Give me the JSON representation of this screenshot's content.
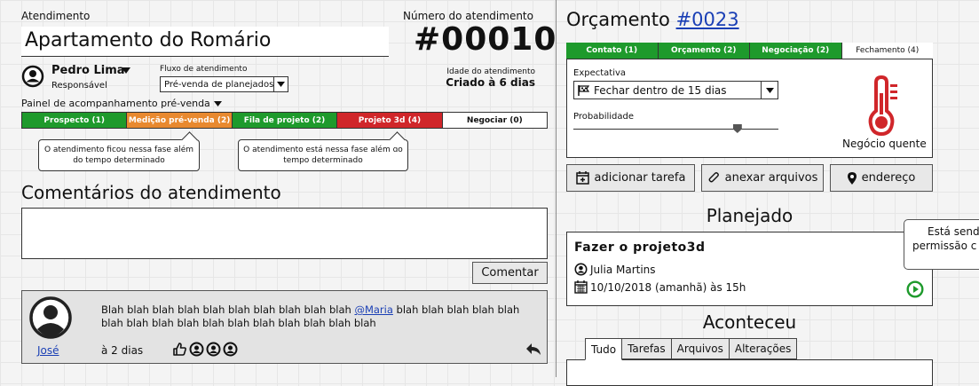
{
  "left": {
    "atendimento_label": "Atendimento",
    "atendimento_title": "Apartamento do Romário",
    "numero_label": "Número do atendimento",
    "numero_value": "#00010",
    "user_name": "Pedro Lima",
    "user_role": "Responsável",
    "fluxo_label": "Fluxo de atendimento",
    "fluxo_value": "Pré-venda de planejados",
    "idade_label": "Idade do atendimento",
    "idade_value": "Criado à 6 dias",
    "painel_label": "Painel de acompanhamento pré-venda",
    "stages": [
      {
        "label": "Prospecto (1)",
        "color": "#1e9a2c"
      },
      {
        "label": "Medição pré-venda (2)",
        "color": "#e8892f"
      },
      {
        "label": "Fila de projeto (2)",
        "color": "#1e9a2c"
      },
      {
        "label": "Projeto 3d (4)",
        "color": "#d0262a"
      },
      {
        "label": "Negociar (0)",
        "color": "#ffffff"
      }
    ],
    "tip1": "O atendimento ficou nessa fase além do tempo determinado",
    "tip2": "O atendimento está nessa fase além do tempo determinado",
    "comments_title": "Comentários do atendimento",
    "comment_button": "Comentar",
    "comment": {
      "author": "José",
      "text_before": "Blah blah blah blah blah blah blah blah blah blah ",
      "mention": "@Maria",
      "text_after": " blah blah blah blah blah blah blah blah blah blah blah blah blah blah blah blah",
      "time": "à 2 dias"
    }
  },
  "right": {
    "orcamento_label": "Orçamento ",
    "orcamento_number": "#0023",
    "tabs": [
      {
        "label": "Contato (1)",
        "color": "#1e9a2c"
      },
      {
        "label": "Orçamento (2)",
        "color": "#1e9a2c"
      },
      {
        "label": "Negociação (2)",
        "color": "#1e9a2c"
      },
      {
        "label": "Fechamento (4)",
        "color": "#ffffff"
      }
    ],
    "expectativa_label": "Expectativa",
    "expectativa_value": "Fechar dentro de 15 dias",
    "probabilidade_label": "Probabilidade",
    "probabilidade_level": 0.8,
    "negocio_label": "Negócio quente",
    "hot_color": "#d0262a",
    "actions": {
      "add_task": "adicionar tarefa",
      "attach": "anexar arquivos",
      "address": "endereço"
    },
    "planejado_title": "Planejado",
    "task": {
      "title": "Fazer o projeto3d",
      "assignee": "Julia Martins",
      "date": "10/10/2018 (amanhã) às 15h"
    },
    "tooltip_line1": "Está send",
    "tooltip_line2": "permissão c",
    "aconteceu_title": "Aconteceu",
    "history_tabs": [
      "Tudo",
      "Tarefas",
      "Arquivos",
      "Alterações"
    ]
  }
}
